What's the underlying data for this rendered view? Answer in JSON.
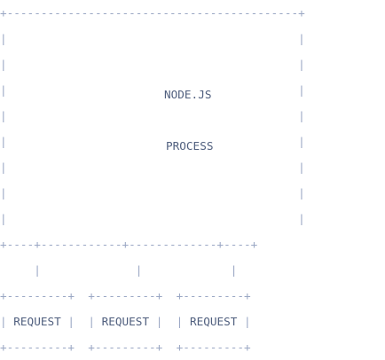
{
  "diagram": {
    "process_title_line1": "NODE.JS",
    "process_title_line2": "PROCESS",
    "requests": [
      {
        "label": "REQUEST"
      },
      {
        "label": "REQUEST"
      },
      {
        "label": "REQUEST"
      }
    ],
    "colors": {
      "border": "#9aa7c4",
      "text": "#51607f",
      "background": "#ffffff"
    }
  }
}
